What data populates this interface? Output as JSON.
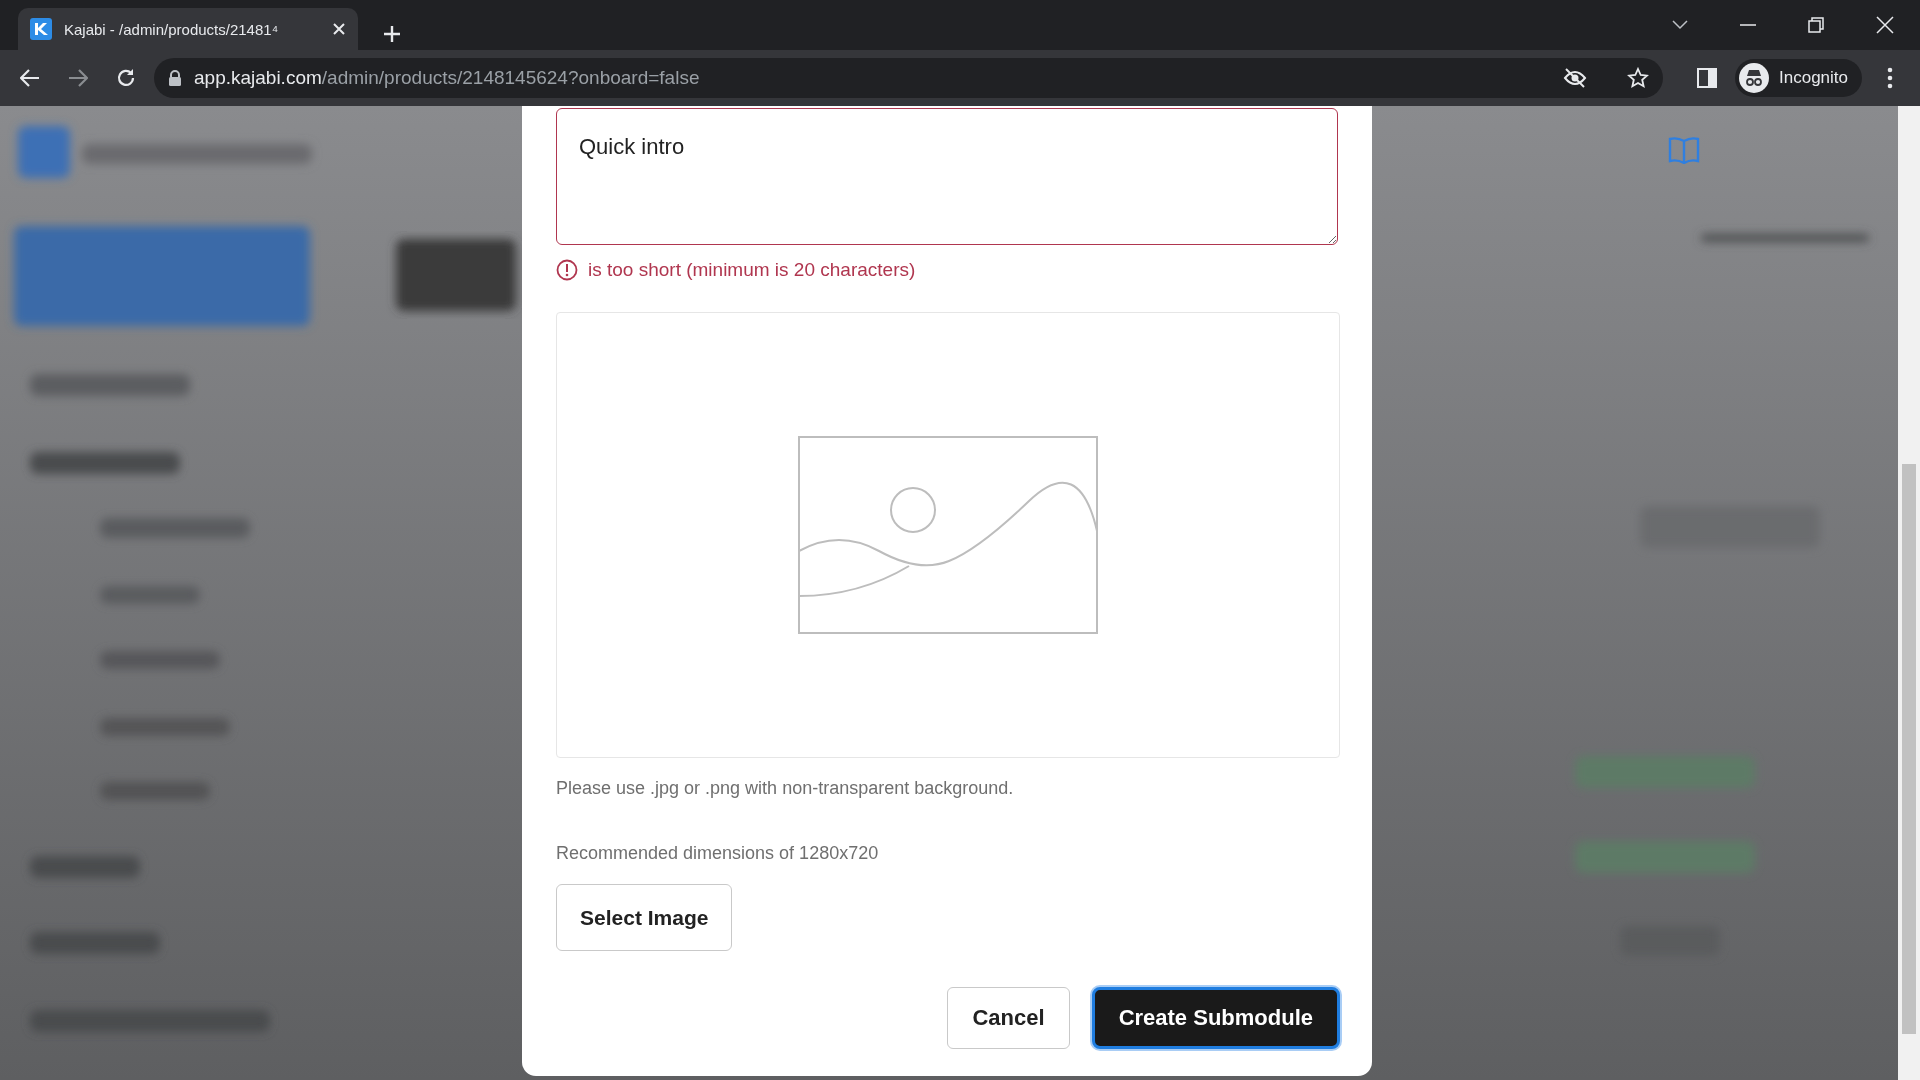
{
  "browser": {
    "tab_title": "Kajabi - /admin/products/21481⁴",
    "url_host": "app.kajabi.com",
    "url_path": "/admin/products/2148145624?onboard=false",
    "profile": "Incognito"
  },
  "dialog": {
    "description_value": "Quick intro",
    "error": "is too short (minimum is 20 characters)",
    "image_hint": "Please use .jpg or .png with non-transparent background.",
    "image_dimensions": "Recommended dimensions of 1280x720",
    "select_image": "Select Image",
    "cancel": "Cancel",
    "submit": "Create Submodule"
  }
}
